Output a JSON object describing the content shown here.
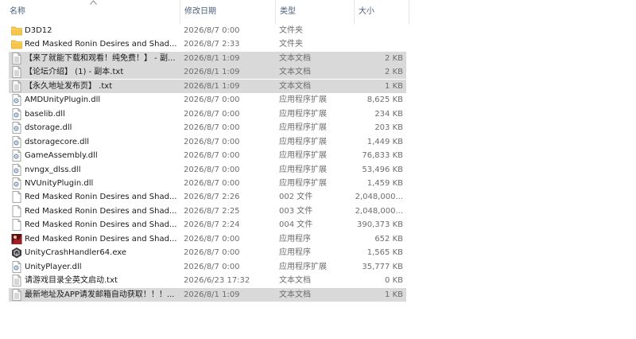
{
  "columns": {
    "name": "名称",
    "date": "修改日期",
    "type": "类型",
    "size": "大小"
  },
  "files": [
    {
      "icon": "folder-icon",
      "name": "D3D12",
      "date": "2026/8/7 0:00",
      "type": "文件夹",
      "size": "",
      "selected": false
    },
    {
      "icon": "folder-icon",
      "name": "Red Masked Ronin Desires and Shad...",
      "date": "2026/8/7 2:33",
      "type": "文件夹",
      "size": "",
      "selected": false
    },
    {
      "icon": "text-file-icon",
      "name": "【来了就能下载和观看！纯免费！】 - 副...",
      "date": "2026/8/1 1:09",
      "type": "文本文档",
      "size": "2 KB",
      "selected": true
    },
    {
      "icon": "text-file-icon",
      "name": "【论坛介绍】 (1) - 副本.txt",
      "date": "2026/8/1 1:09",
      "type": "文本文档",
      "size": "2 KB",
      "selected": true
    },
    {
      "icon": "text-file-icon",
      "name": "【永久地址发布页】 .txt",
      "date": "2026/8/1 1:09",
      "type": "文本文档",
      "size": "1 KB",
      "selected": true
    },
    {
      "icon": "dll-file-icon",
      "name": "AMDUnityPlugin.dll",
      "date": "2026/8/7 0:00",
      "type": "应用程序扩展",
      "size": "8,625 KB",
      "selected": false
    },
    {
      "icon": "dll-file-icon",
      "name": "baselib.dll",
      "date": "2026/8/7 0:00",
      "type": "应用程序扩展",
      "size": "234 KB",
      "selected": false
    },
    {
      "icon": "dll-file-icon",
      "name": "dstorage.dll",
      "date": "2026/8/7 0:00",
      "type": "应用程序扩展",
      "size": "203 KB",
      "selected": false
    },
    {
      "icon": "dll-file-icon",
      "name": "dstoragecore.dll",
      "date": "2026/8/7 0:00",
      "type": "应用程序扩展",
      "size": "1,449 KB",
      "selected": false
    },
    {
      "icon": "dll-file-icon",
      "name": "GameAssembly.dll",
      "date": "2026/8/7 0:00",
      "type": "应用程序扩展",
      "size": "76,833 KB",
      "selected": false
    },
    {
      "icon": "dll-file-icon",
      "name": "nvngx_dlss.dll",
      "date": "2026/8/7 0:00",
      "type": "应用程序扩展",
      "size": "53,496 KB",
      "selected": false
    },
    {
      "icon": "dll-file-icon",
      "name": "NVUnityPlugin.dll",
      "date": "2026/8/7 0:00",
      "type": "应用程序扩展",
      "size": "1,459 KB",
      "selected": false
    },
    {
      "icon": "blank-file-icon",
      "name": "Red Masked Ronin Desires and Shad...",
      "date": "2026/8/7 2:26",
      "type": "002 文件",
      "size": "2,048,000...",
      "selected": false
    },
    {
      "icon": "blank-file-icon",
      "name": "Red Masked Ronin Desires and Shad...",
      "date": "2026/8/7 2:25",
      "type": "003 文件",
      "size": "2,048,000...",
      "selected": false
    },
    {
      "icon": "blank-file-icon",
      "name": "Red Masked Ronin Desires and Shad...",
      "date": "2026/8/7 2:24",
      "type": "004 文件",
      "size": "390,373 KB",
      "selected": false
    },
    {
      "icon": "game-app-icon",
      "name": "Red Masked Ronin Desires and Shad...",
      "date": "2026/8/7 0:00",
      "type": "应用程序",
      "size": "652 KB",
      "selected": false
    },
    {
      "icon": "unity-app-icon",
      "name": "UnityCrashHandler64.exe",
      "date": "2026/8/7 0:00",
      "type": "应用程序",
      "size": "1,565 KB",
      "selected": false
    },
    {
      "icon": "dll-file-icon",
      "name": "UnityPlayer.dll",
      "date": "2026/8/7 0:00",
      "type": "应用程序扩展",
      "size": "35,777 KB",
      "selected": false
    },
    {
      "icon": "text-file-icon",
      "name": "请游戏目录全英文启动.txt",
      "date": "2026/6/23 17:32",
      "type": "文本文档",
      "size": "0 KB",
      "selected": false
    },
    {
      "icon": "text-file-icon",
      "name": "最新地址及APP请发邮箱自动获取！！！...",
      "date": "2026/8/1 1:09",
      "type": "文本文档",
      "size": "1 KB",
      "selected": true
    }
  ]
}
